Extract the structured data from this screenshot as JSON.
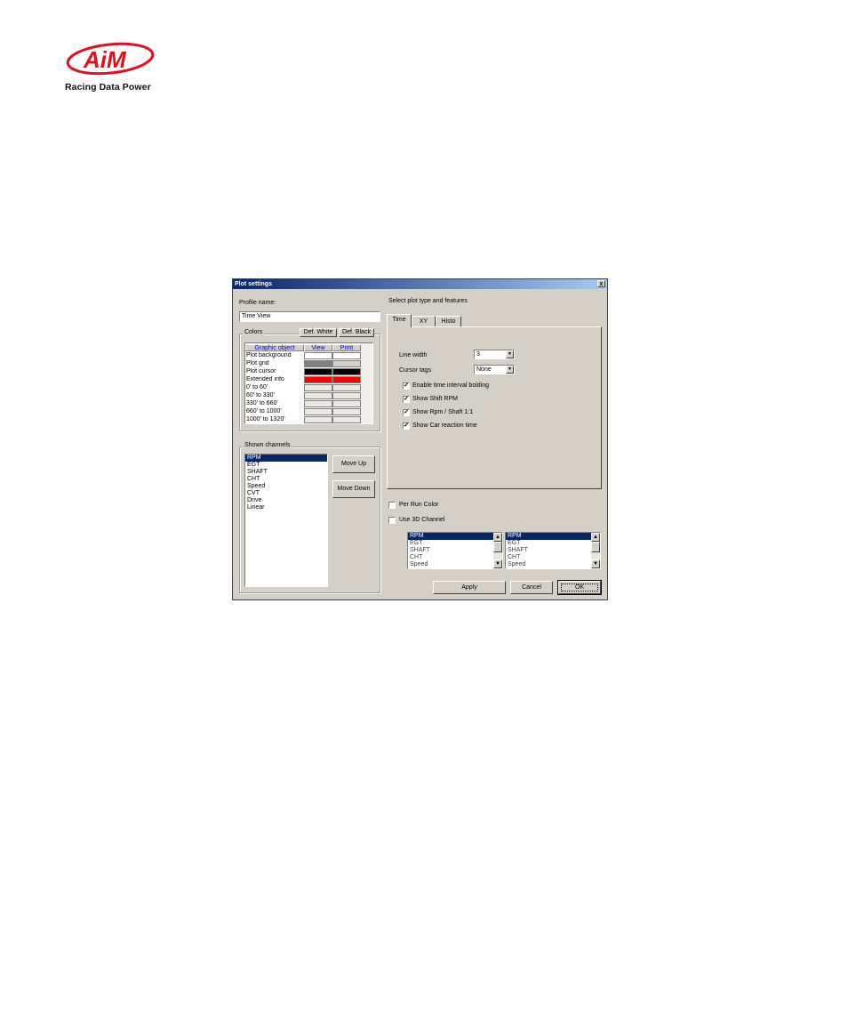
{
  "brand": {
    "logo_text": "AiM",
    "tagline": "Racing Data Power",
    "logo_color": "#e3101a"
  },
  "dialog": {
    "title": "Plot settings",
    "close_glyph": "x",
    "profile_label": "Profile name:",
    "profile_value": "Time View",
    "colors": {
      "legend": "Colors",
      "def_white": "Def. White",
      "def_black": "Def. Black",
      "headers": [
        "Graphic object",
        "View",
        "Print"
      ],
      "rows": [
        {
          "name": "Plot background",
          "view": "#ffffff",
          "print": "#ffffff"
        },
        {
          "name": "Plot grid",
          "view": "#808080",
          "print": "#d4d0c8"
        },
        {
          "name": "Plot cursor",
          "view": "#000000",
          "print": "#000000"
        },
        {
          "name": "Extended info",
          "view": "#ff0000",
          "print": "#ff0000"
        },
        {
          "name": "0' to 60'",
          "view": "#ece9e2",
          "print": "#ece9e2"
        },
        {
          "name": "60' to 330'",
          "view": "#ece9e2",
          "print": "#ece9e2"
        },
        {
          "name": "330' to 660'",
          "view": "#ece9e2",
          "print": "#ece9e2"
        },
        {
          "name": "660' to 1000'",
          "view": "#ece9e2",
          "print": "#ece9e2"
        },
        {
          "name": "1000' to 1320'",
          "view": "#ece9e2",
          "print": "#ece9e2"
        }
      ]
    },
    "channels": {
      "legend": "Shown channels",
      "items": [
        "RPM",
        "EGT",
        "SHAFT",
        "CHT",
        "Speed",
        "CVT",
        "Drive",
        "Linear"
      ],
      "selected_index": 0,
      "move_up": "Move Up",
      "move_down": "Move Down"
    },
    "plot_type": {
      "label": "Select plot type and features",
      "tabs": [
        "Time",
        "XY",
        "Histo"
      ],
      "active_tab": 0,
      "line_width_label": "Line width",
      "line_width_value": "3",
      "cursor_tags_label": "Cursor tags",
      "cursor_tags_value": "None",
      "checkboxes": [
        {
          "label": "Enable time interval bolding",
          "checked": true
        },
        {
          "label": "Show Shift RPM",
          "checked": true
        },
        {
          "label": "Show Rpm / Shaft 1:1",
          "checked": true
        },
        {
          "label": "Show Car reaction time",
          "checked": true
        }
      ]
    },
    "per_run_color": {
      "label": "Per Run Color",
      "checked": false
    },
    "use_3d": {
      "label": "Use 3D Channel",
      "checked": false
    },
    "mini_lists": [
      {
        "items": [
          "RPM",
          "EGT",
          "SHAFT",
          "CHT",
          "Speed"
        ],
        "selected_index": 0
      },
      {
        "items": [
          "RPM",
          "EGT",
          "SHAFT",
          "CHT",
          "Speed"
        ],
        "selected_index": 0
      }
    ],
    "buttons": {
      "apply": "Apply",
      "cancel": "Cancel",
      "ok": "OK"
    },
    "arrows": {
      "up": "▲",
      "down": "▼"
    }
  }
}
